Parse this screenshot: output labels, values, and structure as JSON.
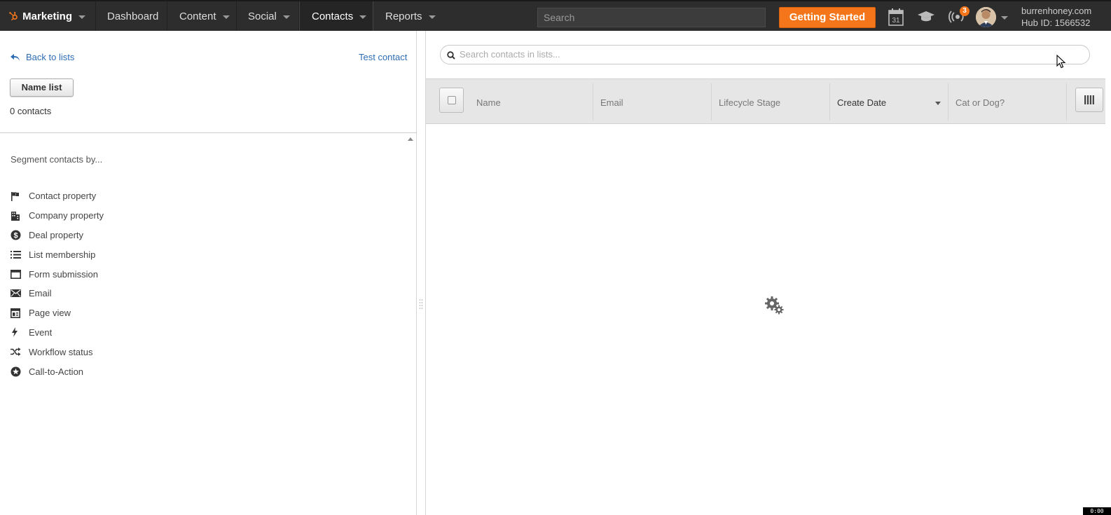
{
  "nav": {
    "brand": "Marketing",
    "items": [
      {
        "label": "Dashboard",
        "caret": false
      },
      {
        "label": "Content",
        "caret": true
      },
      {
        "label": "Social",
        "caret": true
      },
      {
        "label": "Contacts",
        "caret": true,
        "active": true
      },
      {
        "label": "Reports",
        "caret": true
      }
    ],
    "search_placeholder": "Search",
    "getting_started": "Getting Started",
    "calendar_day": "31",
    "notifications_count": "3",
    "account_name": "burrenhoney.com",
    "hub_id": "Hub ID: 1566532"
  },
  "left": {
    "back_label": "Back to lists",
    "test_contact": "Test contact",
    "name_list_button": "Name list",
    "contact_count": "0 contacts",
    "segment_title": "Segment contacts by...",
    "segments": [
      {
        "label": "Contact property",
        "icon": "flag-icon"
      },
      {
        "label": "Company property",
        "icon": "building-icon"
      },
      {
        "label": "Deal property",
        "icon": "dollar-coin-icon"
      },
      {
        "label": "List membership",
        "icon": "list-icon"
      },
      {
        "label": "Form submission",
        "icon": "form-icon"
      },
      {
        "label": "Email",
        "icon": "envelope-icon"
      },
      {
        "label": "Page view",
        "icon": "page-layout-icon"
      },
      {
        "label": "Event",
        "icon": "lightning-icon"
      },
      {
        "label": "Workflow status",
        "icon": "shuffle-icon"
      },
      {
        "label": "Call-to-Action",
        "icon": "star-badge-icon"
      }
    ]
  },
  "right": {
    "search_placeholder": "Search contacts in lists...",
    "columns": [
      {
        "label": "Name",
        "sorted": false
      },
      {
        "label": "Email",
        "sorted": false
      },
      {
        "label": "Lifecycle Stage",
        "sorted": false
      },
      {
        "label": "Create Date",
        "sorted": true
      },
      {
        "label": "Cat or Dog?",
        "sorted": false
      }
    ]
  },
  "recorder_time": "0:00",
  "colors": {
    "nav_bg": "#2d2d2d",
    "accent_orange": "#f5761a",
    "link_blue": "#2e6db4"
  }
}
